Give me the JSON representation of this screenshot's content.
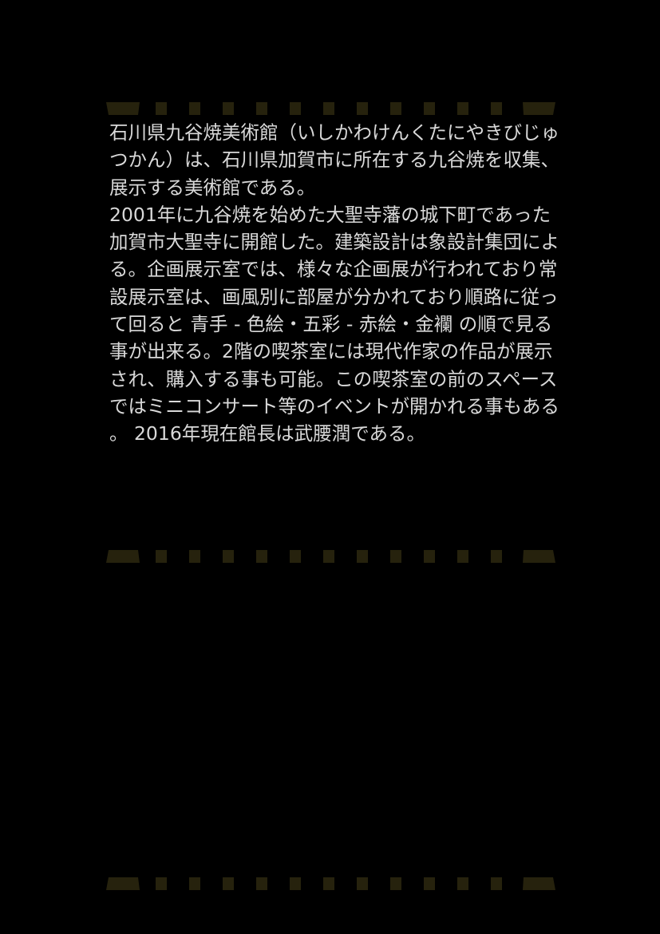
{
  "colors": {
    "background": "#000000",
    "text": "#d9d9d9",
    "divider": "#26220d"
  },
  "article": {
    "paragraph_1": "石川県九谷焼美術館（いしかわけんくたにやきびじゅつかん）は、石川県加賀市に所在する九谷焼を収集、展示する美術館である。",
    "paragraph_2": "2001年に九谷焼を始めた大聖寺藩の城下町であった加賀市大聖寺に開館した。建築設計は象設計集団による。企画展示室では、様々な企画展が行われており常設展示室は、画風別に部屋が分かれており順路に従って回ると 青手 - 色絵・五彩 - 赤絵・金襴 の順で見る事が出来る。2階の喫茶室には現代作家の作品が展示され、購入する事も可能。この喫茶室の前のスペースではミニコンサート等のイベントが開かれる事もある。 2016年現在館長は武腰潤である。"
  }
}
